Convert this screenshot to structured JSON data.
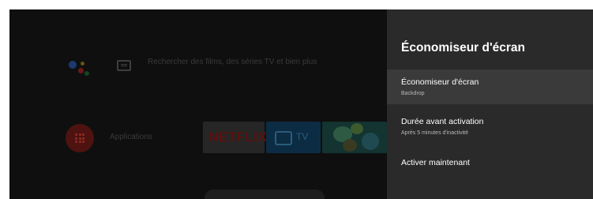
{
  "home": {
    "search_placeholder": "Rechercher des films, des séries TV et bien plus",
    "apps_label": "Applications",
    "tiles": {
      "netflix": "NETFLIX",
      "tv": "TV"
    }
  },
  "panel": {
    "title": "Économiseur d'écran",
    "items": [
      {
        "title": "Économiseur d'écran",
        "subtitle": "Backdrop"
      },
      {
        "title": "Durée avant activation",
        "subtitle": "Après 5 minutes d'inactivité"
      },
      {
        "title": "Activer maintenant"
      }
    ]
  },
  "colors": {
    "panel_bg": "#2a2a2a",
    "selected_bg": "#3a3a3a",
    "netflix_red": "#5b1210"
  }
}
